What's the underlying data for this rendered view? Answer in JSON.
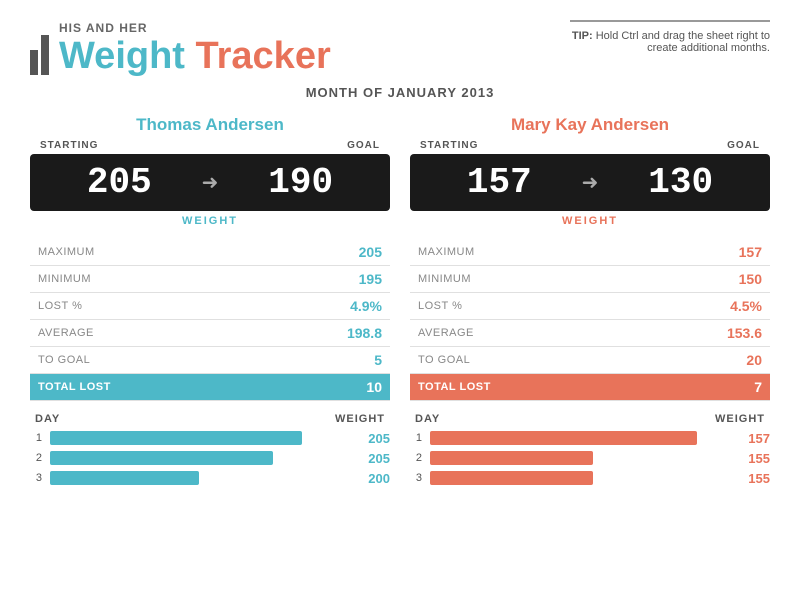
{
  "header": {
    "subtitle": "HIS AND HER",
    "title_blue": "Weight",
    "title_orange": "Tracker",
    "tip_label": "TIP:",
    "tip_text": "Hold Ctrl and drag the sheet right to create additional months."
  },
  "month": "MONTH OF JANUARY 2013",
  "thomas": {
    "name": "Thomas Andersen",
    "color": "blue",
    "starting": "205",
    "goal": "190",
    "weight_label": "WEIGHT",
    "starting_label": "STARTING",
    "goal_label": "GOAL",
    "stats": [
      {
        "label": "MAXIMUM",
        "value": "205"
      },
      {
        "label": "MINIMUM",
        "value": "195"
      },
      {
        "label": "LOST %",
        "value": "4.9%"
      },
      {
        "label": "AVERAGE",
        "value": "198.8"
      },
      {
        "label": "TO GOAL",
        "value": "5"
      }
    ],
    "total_lost_label": "TOTAL LOST",
    "total_lost_value": "10",
    "days": [
      {
        "day": "1",
        "weight": "205",
        "bar_pct": 85
      },
      {
        "day": "2",
        "weight": "205",
        "bar_pct": 75
      },
      {
        "day": "3",
        "weight": "200",
        "bar_pct": 50
      }
    ]
  },
  "mary": {
    "name": "Mary Kay Andersen",
    "color": "orange",
    "starting": "157",
    "goal": "130",
    "weight_label": "WEIGHT",
    "starting_label": "STARTING",
    "goal_label": "GOAL",
    "stats": [
      {
        "label": "MAXIMUM",
        "value": "157"
      },
      {
        "label": "MINIMUM",
        "value": "150"
      },
      {
        "label": "LOST %",
        "value": "4.5%"
      },
      {
        "label": "AVERAGE",
        "value": "153.6"
      },
      {
        "label": "TO GOAL",
        "value": "20"
      }
    ],
    "total_lost_label": "TOTAL LOST",
    "total_lost_value": "7",
    "days": [
      {
        "day": "1",
        "weight": "157",
        "bar_pct": 90
      },
      {
        "day": "2",
        "weight": "155",
        "bar_pct": 55
      },
      {
        "day": "3",
        "weight": "155",
        "bar_pct": 55
      }
    ]
  }
}
